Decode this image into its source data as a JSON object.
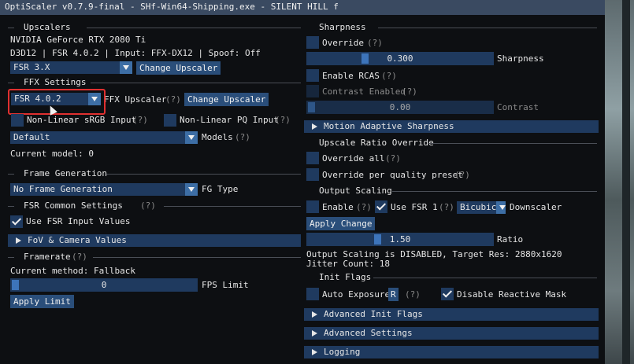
{
  "window": {
    "title": "OptiScaler v0.7.9-final - SHf-Win64-Shipping.exe - SILENT HILL f"
  },
  "upscalers": {
    "section_title": "Upscalers",
    "gpu": "NVIDIA GeForce RTX 2080 Ti",
    "info": "D3D12 | FSR 4.0.2 | Input: FFX-DX12 | Spoof: Off",
    "combo_value": "FSR 3.X",
    "change_button": "Change Upscaler"
  },
  "ffx": {
    "section_title": "FFX Settings",
    "combo_value": "FSR 4.0.2",
    "combo_label": "FFX Upscaler",
    "help": "(?)",
    "change_button": "Change Upscaler",
    "nonlinear_srgb": "Non-Linear sRGB Input",
    "nonlinear_pq": "Non-Linear PQ Input",
    "model_combo": "Default",
    "model_label": "Models",
    "current_model": "Current model: 0"
  },
  "frame_generation": {
    "section_title": "Frame Generation",
    "combo_value": "No Frame Generation",
    "combo_label": "FG Type"
  },
  "fsr_common": {
    "section_title": "FSR Common Settings",
    "help": "(?)",
    "use_input_values": "Use FSR Input Values",
    "use_input_values_checked": true
  },
  "fov_header": "FoV & Camera Values",
  "framerate": {
    "section_title": "Framerate",
    "help": "(?)",
    "current_method": "Current method: Fallback",
    "fps_value": "0",
    "fps_label": "FPS Limit",
    "apply_button": "Apply Limit"
  },
  "sharpness": {
    "section_title": "Sharpness",
    "override_label": "Override",
    "help": "(?)",
    "slider_value": "0.300",
    "slider_level": 0.3,
    "slider_label": "Sharpness",
    "enable_rcas": "Enable RCAS",
    "contrast_enabled": "Contrast Enabled",
    "contrast_value": "0.00",
    "contrast_level": 0.0,
    "contrast_label": "Contrast"
  },
  "motion_header": "Motion Adaptive Sharpness",
  "upscale_ratio": {
    "section_title": "Upscale Ratio Override",
    "override_all": "Override all",
    "override_quality": "Override per quality preset",
    "help": "(?)"
  },
  "output_scaling": {
    "section_title": "Output Scaling",
    "enable_label": "Enable",
    "help": "(?)",
    "use_fsr1": "Use FSR 1",
    "use_fsr1_checked": true,
    "downscaler_value": "Bicubic",
    "downscaler_label": "Downscaler",
    "apply_button": "Apply Change",
    "ratio_value": "1.50",
    "ratio_level": 0.375,
    "ratio_label": "Ratio",
    "status": "Output Scaling is DISABLED, Target Res: 2880x1620",
    "jitter": "Jitter Count: 18"
  },
  "init_flags": {
    "section_title": "Init Flags",
    "auto_exposure": "Auto Exposure",
    "r_button": "R",
    "help": "(?)",
    "disable_reactive": "Disable Reactive Mask",
    "disable_reactive_checked": true
  },
  "advanced_init_header": "Advanced Init Flags",
  "advanced_settings_header": "Advanced Settings",
  "logging_header": "Logging",
  "colors": {
    "title_bar": "#3a4a61",
    "window_bg": "#0d0f12",
    "frame_bg": "#1f3a5f",
    "button": "#2a4e7a",
    "accent": "#3d74ba",
    "highlight_box": "#e03030"
  }
}
